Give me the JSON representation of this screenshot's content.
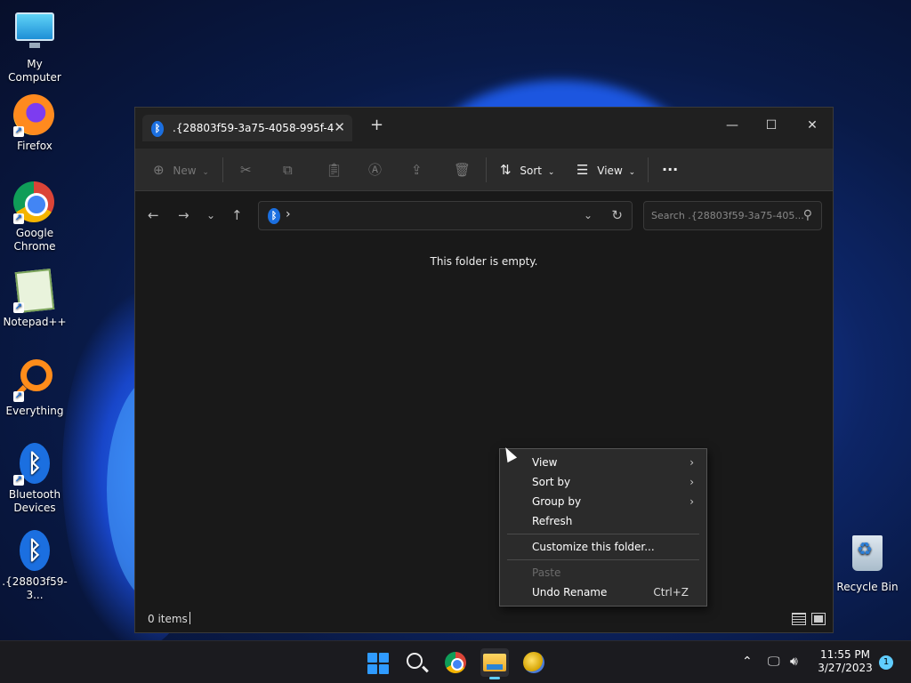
{
  "desktop": {
    "icons": [
      {
        "label": "My Computer"
      },
      {
        "label": "Firefox"
      },
      {
        "label": "Google Chrome"
      },
      {
        "label": "Notepad++"
      },
      {
        "label": "Everything"
      },
      {
        "label": "Bluetooth Devices"
      },
      {
        "label": ".{28803f59-3..."
      },
      {
        "label": "Recycle Bin"
      }
    ]
  },
  "explorer": {
    "tab_title": ".{28803f59-3a75-4058-995f-4",
    "toolbar": {
      "new_label": "New",
      "sort_label": "Sort",
      "view_label": "View",
      "more_label": "···"
    },
    "address": {
      "path_chevron": "›"
    },
    "search": {
      "placeholder": "Search .{28803f59-3a75-405..."
    },
    "content": {
      "empty_message": "This folder is empty."
    },
    "status": {
      "item_count": "0 items"
    }
  },
  "context_menu": {
    "items": [
      {
        "label": "View",
        "submenu": true
      },
      {
        "label": "Sort by",
        "submenu": true
      },
      {
        "label": "Group by",
        "submenu": true
      },
      {
        "label": "Refresh"
      },
      {
        "label": "Customize this folder..."
      },
      {
        "label": "Paste",
        "disabled": true
      },
      {
        "label": "Undo Rename",
        "shortcut": "Ctrl+Z"
      }
    ]
  },
  "taskbar": {
    "clock": {
      "time": "11:55 PM",
      "date": "3/27/2023"
    },
    "notification_count": "1"
  }
}
